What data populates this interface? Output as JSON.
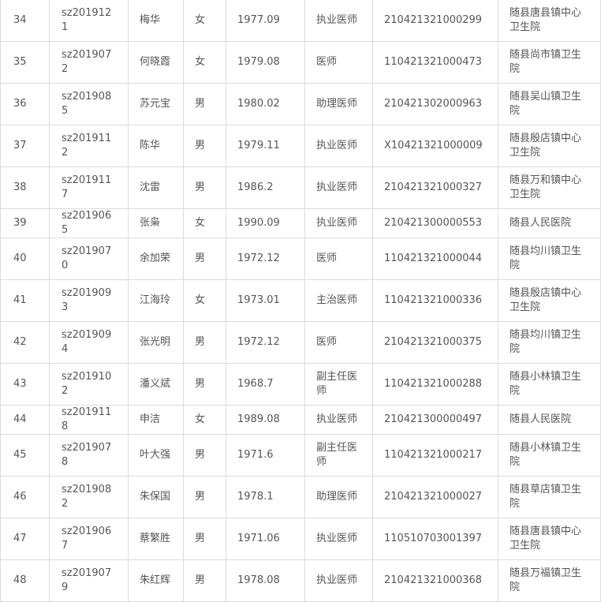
{
  "rows": [
    {
      "no": "34",
      "code": "sz2019121",
      "name": "梅华",
      "sex": "女",
      "birth": "1977.09",
      "title": "执业医师",
      "cert": "210421321000299",
      "unit": "随县唐县镇中心卫生院"
    },
    {
      "no": "35",
      "code": "sz2019072",
      "name": "何晓霞",
      "sex": "女",
      "birth": "1979.08",
      "title": "医师",
      "cert": "110421321000473",
      "unit": "随县尚市镇卫生院"
    },
    {
      "no": "36",
      "code": "sz2019085",
      "name": "苏元宝",
      "sex": "男",
      "birth": "1980.02",
      "title": "助理医师",
      "cert": "210421302000963",
      "unit": "随县吴山镇卫生院"
    },
    {
      "no": "37",
      "code": "sz2019112",
      "name": "陈华",
      "sex": "男",
      "birth": "1979.11",
      "title": "执业医师",
      "cert": "X10421321000009",
      "unit": "随县殷店镇中心卫生院"
    },
    {
      "no": "38",
      "code": "sz2019117",
      "name": "沈雷",
      "sex": "男",
      "birth": "1986.2",
      "title": "执业医师",
      "cert": "210421321000327",
      "unit": "随县万和镇中心卫生院"
    },
    {
      "no": "39",
      "code": "sz2019065",
      "name": "张枭",
      "sex": "女",
      "birth": "1990.09",
      "title": "执业医师",
      "cert": "210421300000553",
      "unit": "随县人民医院"
    },
    {
      "no": "40",
      "code": "sz2019070",
      "name": "余加荣",
      "sex": "男",
      "birth": "1972.12",
      "title": "医师",
      "cert": "110421321000044",
      "unit": "随县均川镇卫生院"
    },
    {
      "no": "41",
      "code": "sz2019093",
      "name": "江海玲",
      "sex": "女",
      "birth": "1973.01",
      "title": "主治医师",
      "cert": "110421321000336",
      "unit": "随县殷店镇中心卫生院"
    },
    {
      "no": "42",
      "code": "sz2019094",
      "name": "张光明",
      "sex": "男",
      "birth": "1972.12",
      "title": "医师",
      "cert": "210421321000375",
      "unit": "随县均川镇卫生院"
    },
    {
      "no": "43",
      "code": "sz2019102",
      "name": "潘义斌",
      "sex": "男",
      "birth": "1968.7",
      "title": "副主任医师",
      "cert": "110421321000288",
      "unit": "随县小林镇卫生院"
    },
    {
      "no": "44",
      "code": "sz2019118",
      "name": "申洁",
      "sex": "女",
      "birth": "1989.08",
      "title": "执业医师",
      "cert": "210421300000497",
      "unit": "随县人民医院"
    },
    {
      "no": "45",
      "code": "sz2019078",
      "name": "叶大强",
      "sex": "男",
      "birth": "1971.6",
      "title": "副主任医师",
      "cert": "110421321000217",
      "unit": "随县小林镇卫生院"
    },
    {
      "no": "46",
      "code": "sz2019082",
      "name": "朱保国",
      "sex": "男",
      "birth": "1978.1",
      "title": "助理医师",
      "cert": "210421321000027",
      "unit": "随县草店镇卫生院"
    },
    {
      "no": "47",
      "code": "sz2019067",
      "name": "蔡繁胜",
      "sex": "男",
      "birth": "1971.06",
      "title": "执业医师",
      "cert": "110510703001397",
      "unit": "随县唐县镇中心卫生院"
    },
    {
      "no": "48",
      "code": "sz2019079",
      "name": "朱红辉",
      "sex": "男",
      "birth": "1978.08",
      "title": "执业医师",
      "cert": "210421321000368",
      "unit": "随县万福镇卫生院"
    }
  ]
}
